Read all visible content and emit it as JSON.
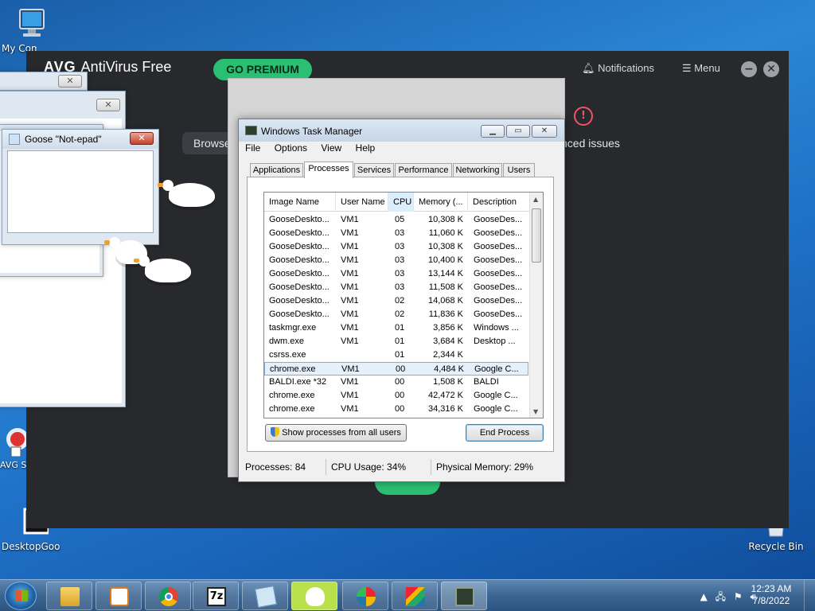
{
  "desktop": {
    "icons": [
      {
        "label": "My Computer"
      },
      {
        "label": "AVG Secure Browser"
      },
      {
        "label": "DesktopGoose"
      },
      {
        "label": "Recycle Bin"
      }
    ]
  },
  "avg": {
    "brand": "AVG",
    "product": "AntiVirus Free",
    "premium_label": "GO PREMIUM",
    "notifications_label": "Notifications",
    "menu_label": "Menu",
    "browse_label": "Browse",
    "issues_label": "nced issues",
    "minimize_glyph": "−",
    "close_glyph": "✕"
  },
  "notepad": {
    "title": "Goose \"Not-epad\""
  },
  "taskmgr": {
    "title": "Windows Task Manager",
    "menu": [
      "File",
      "Options",
      "View",
      "Help"
    ],
    "tabs": [
      "Applications",
      "Processes",
      "Services",
      "Performance",
      "Networking",
      "Users"
    ],
    "active_tab": "Processes",
    "columns": [
      "Image Name",
      "User Name",
      "CPU",
      "Memory (...",
      "Description"
    ],
    "rows": [
      {
        "name": "GooseDeskto...",
        "user": "VM1",
        "cpu": "05",
        "mem": "10,308 K",
        "desc": "GooseDes..."
      },
      {
        "name": "GooseDeskto...",
        "user": "VM1",
        "cpu": "03",
        "mem": "11,060 K",
        "desc": "GooseDes..."
      },
      {
        "name": "GooseDeskto...",
        "user": "VM1",
        "cpu": "03",
        "mem": "10,308 K",
        "desc": "GooseDes..."
      },
      {
        "name": "GooseDeskto...",
        "user": "VM1",
        "cpu": "03",
        "mem": "10,400 K",
        "desc": "GooseDes..."
      },
      {
        "name": "GooseDeskto...",
        "user": "VM1",
        "cpu": "03",
        "mem": "13,144 K",
        "desc": "GooseDes..."
      },
      {
        "name": "GooseDeskto...",
        "user": "VM1",
        "cpu": "03",
        "mem": "11,508 K",
        "desc": "GooseDes..."
      },
      {
        "name": "GooseDeskto...",
        "user": "VM1",
        "cpu": "02",
        "mem": "14,068 K",
        "desc": "GooseDes..."
      },
      {
        "name": "GooseDeskto...",
        "user": "VM1",
        "cpu": "02",
        "mem": "11,836 K",
        "desc": "GooseDes..."
      },
      {
        "name": "taskmgr.exe",
        "user": "VM1",
        "cpu": "01",
        "mem": "3,856 K",
        "desc": "Windows ..."
      },
      {
        "name": "dwm.exe",
        "user": "VM1",
        "cpu": "01",
        "mem": "3,684 K",
        "desc": "Desktop ..."
      },
      {
        "name": "csrss.exe",
        "user": "",
        "cpu": "01",
        "mem": "2,344 K",
        "desc": ""
      },
      {
        "name": "chrome.exe",
        "user": "VM1",
        "cpu": "00",
        "mem": "4,484 K",
        "desc": "Google C...",
        "selected": true
      },
      {
        "name": "BALDI.exe *32",
        "user": "VM1",
        "cpu": "00",
        "mem": "1,508 K",
        "desc": "BALDI"
      },
      {
        "name": "chrome.exe",
        "user": "VM1",
        "cpu": "00",
        "mem": "42,472 K",
        "desc": "Google C..."
      },
      {
        "name": "chrome.exe",
        "user": "VM1",
        "cpu": "00",
        "mem": "34,316 K",
        "desc": "Google C..."
      }
    ],
    "show_all_label": "Show processes from all users",
    "end_process_label": "End Process",
    "status": {
      "processes": "Processes: 84",
      "cpu": "CPU Usage: 34%",
      "memory": "Physical Memory: 29%"
    }
  },
  "taskbar": {
    "pinned": [
      "explorer-icon",
      "media-player-icon",
      "chrome-icon",
      "7zip-icon",
      "notepad-icon",
      "goose-icon",
      "avg-browser-icon",
      "avg-antivirus-icon",
      "task-manager-icon"
    ],
    "clock_time": "12:23 AM",
    "clock_date": "7/8/2022"
  },
  "colors": {
    "avg_green": "#2bbf73",
    "avg_bg": "#27292d",
    "selection": "#e6f0fa"
  }
}
